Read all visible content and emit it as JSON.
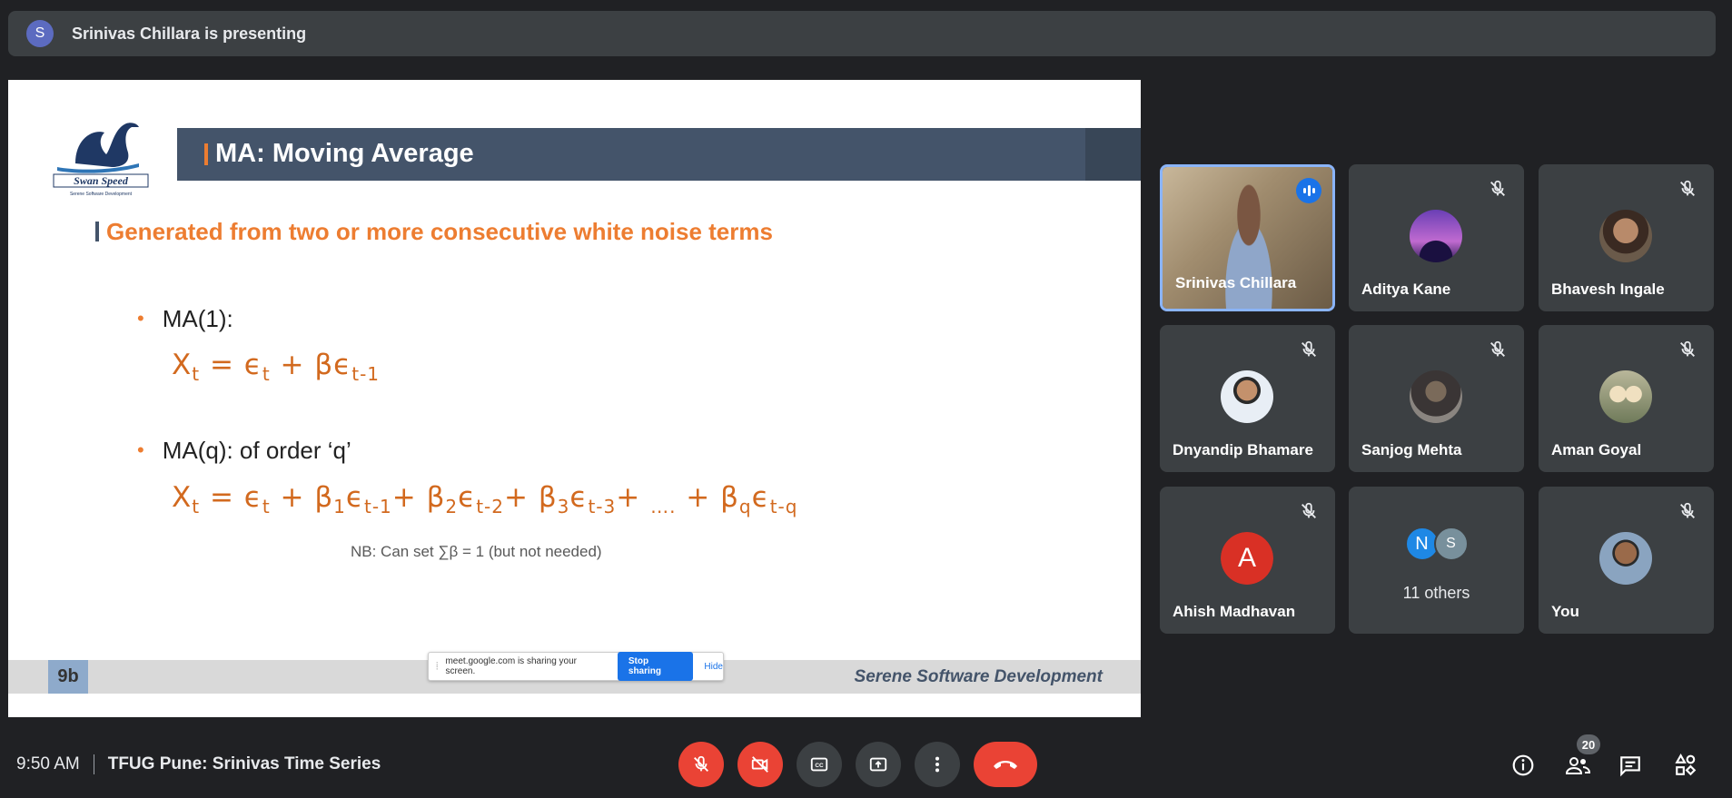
{
  "banner": {
    "avatar_letter": "S",
    "text": "Srinivas Chillara is presenting"
  },
  "slide": {
    "logo_text": "Swan Speed",
    "logo_tagline": "Serene Software Development",
    "title": "MA: Moving Average",
    "subhead": "Generated from two or more consecutive white noise terms",
    "bullet1": "MA(1):",
    "bullet2": "MA(q): of order ‘q’",
    "nb": "NB: Can set ∑β = 1 (but not needed)",
    "slide_number": "9b",
    "footer_brand": "Serene Software Development"
  },
  "share_bar": {
    "text": "meet.google.com is sharing your screen.",
    "stop_label": "Stop sharing",
    "hide_label": "Hide"
  },
  "participants": [
    {
      "name": "Srinivas Chillara"
    },
    {
      "name": "Aditya Kane"
    },
    {
      "name": "Bhavesh Ingale"
    },
    {
      "name": "Dnyandip Bhamare"
    },
    {
      "name": "Sanjog Mehta"
    },
    {
      "name": "Aman Goyal"
    },
    {
      "name": "Ahish Madhavan",
      "avatar_letter": "A"
    },
    {
      "name": "You"
    }
  ],
  "others": {
    "label": "11 others",
    "letters": [
      "N",
      "S"
    ]
  },
  "bottom": {
    "time": "9:50 AM",
    "meeting_title": "TFUG Pune: Srinivas Time Series",
    "participant_count": "20"
  },
  "colors": {
    "accent_red": "#ea4335",
    "speaking_blue": "#1a73e8",
    "slide_orange": "#ed7d31"
  }
}
